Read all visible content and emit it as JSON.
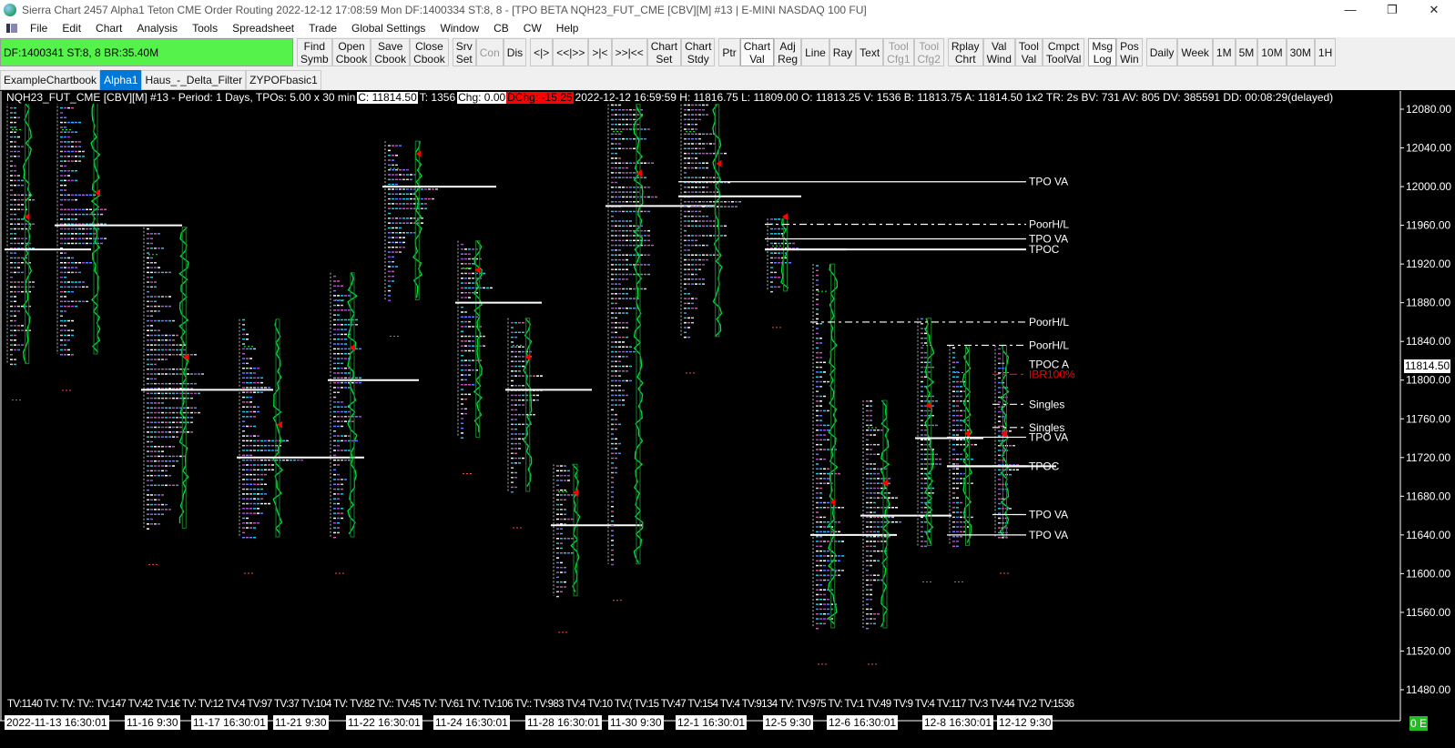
{
  "window": {
    "title": "Sierra Chart 2457 Alpha1  Teton CME Order Routing 2022-12-12  17:08:59 Mon  DF:1400334  ST:8, 8 - [TPO BETA NQH23_FUT_CME [CBV][M]  #13 | E-MINI NASDAQ 100 FU]",
    "minimize": "—",
    "restore": "❐",
    "close": "✕"
  },
  "menu": [
    "File",
    "Edit",
    "Chart",
    "Analysis",
    "Tools",
    "Spreadsheet",
    "Trade",
    "Global Settings",
    "Window",
    "CB",
    "CW",
    "Help"
  ],
  "status": "DF:1400341  ST:8, 8  BR:35.40M",
  "toolbar": [
    [
      {
        "l1": "Find",
        "l2": "Symb"
      },
      {
        "l1": "Open",
        "l2": "Cbook"
      },
      {
        "l1": "Save",
        "l2": "Cbook"
      },
      {
        "l1": "Close",
        "l2": "Cbook"
      }
    ],
    [
      {
        "l1": "Srv",
        "l2": "Set"
      },
      {
        "l1": "Con",
        "l2": "",
        "dis": true
      },
      {
        "l1": "Dis",
        "l2": ""
      }
    ],
    [
      {
        "l1": "<|>",
        "l2": ""
      },
      {
        "l1": "<<|>>",
        "l2": ""
      },
      {
        "l1": ">|<",
        "l2": ""
      },
      {
        "l1": ">>|<<",
        "l2": ""
      },
      {
        "l1": "Chart",
        "l2": "Set"
      },
      {
        "l1": "Chart",
        "l2": "Stdy"
      }
    ],
    [
      {
        "l1": "Ptr",
        "l2": ""
      },
      {
        "l1": "Chart",
        "l2": "Val",
        "act": true
      },
      {
        "l1": "Adj",
        "l2": "Reg"
      },
      {
        "l1": "Line",
        "l2": ""
      },
      {
        "l1": "Ray",
        "l2": ""
      },
      {
        "l1": "Text",
        "l2": ""
      },
      {
        "l1": "Tool",
        "l2": "Cfg1",
        "dis": true
      },
      {
        "l1": "Tool",
        "l2": "Cfg2",
        "dis": true
      }
    ],
    [
      {
        "l1": "Rplay",
        "l2": "Chrt"
      },
      {
        "l1": "Val",
        "l2": "Wind"
      },
      {
        "l1": "Tool",
        "l2": "Val"
      },
      {
        "l1": "Cmpct",
        "l2": "ToolVal"
      }
    ],
    [
      {
        "l1": "Msg",
        "l2": "Log",
        "act": true
      },
      {
        "l1": "Pos",
        "l2": "Win"
      }
    ],
    [
      {
        "l1": "Daily",
        "l2": ""
      },
      {
        "l1": "Week",
        "l2": ""
      },
      {
        "l1": "1M",
        "l2": ""
      },
      {
        "l1": "5M",
        "l2": ""
      },
      {
        "l1": "10M",
        "l2": ""
      },
      {
        "l1": "30M",
        "l2": ""
      },
      {
        "l1": "1H",
        "l2": ""
      }
    ]
  ],
  "tabs": [
    "ExampleChartbook",
    "Alpha1",
    "Haus_-_Delta_Filter",
    "ZYPOFbasic1"
  ],
  "header": {
    "symbol": "NQH23_FUT_CME [CBV][M]  #13 - Period: 1 Days, TPOs: 5.00 x 30 min ",
    "close": "C: 11814.50",
    "trades": "T: 1356",
    "chg": "Chg: 0.00",
    "dchg": "DChg: -15.25",
    "rest": "2022-12-12 16:59:59 H: 11816.75 L: 11809.00 O: 11813.25 V: 1536 B: 11813.75 A: 11814.50 1x2 TR: 2s BV: 731 AV: 805 DV: 385591 DD: 00:08:29(delayed)"
  },
  "last_price": "11814.50",
  "tv_row": "TV:1140 TV: TV: TV:: TV:147 TV:42 TV:1€ TV: TV:12 TV:4 TV:97 TV:37 TV:104 TV: TV:82 TV:: TV:45 TV: TV:61 TV: TV:106 TV:: TV:983 TV:4 TV:10 TV:( TV:15 TV:47 TV:154 TV:4 TV:9134 TV: TV:975 TV: TV:1 TV:49 TV:9 TV:4 TV:117 TV:3 TV:44 TV:2 TV:1536",
  "dates": [
    "2022-11-13  16:30:01",
    "11-16  9:30",
    "11-17  16:30:01",
    "11-21  9:30",
    "11-22  16:30:01",
    "11-24  16:30:01",
    "11-28  16:30:01",
    "11-30  9:30",
    "12-1  16:30:01",
    "12-5  9:30",
    "12-6  16:30:01",
    "12-8  16:30:01",
    "12-12  9:30"
  ],
  "oe_badge": "0 E",
  "colors": {
    "status_green": "#55f24b",
    "tab_selected": "#0078d7",
    "dchg_red": "#ff0000",
    "price_line": "#00e040",
    "tpo_cyan": "#29c6e0",
    "tpo_purple": "#a050c0"
  },
  "chart_data": {
    "type": "tpo-profile",
    "ylim": [
      11460,
      12095
    ],
    "y_ticks": [
      12080,
      12040,
      12000,
      11960,
      11920,
      11880,
      11840,
      11800,
      11760,
      11720,
      11680,
      11640,
      11600,
      11560,
      11520,
      11480
    ],
    "sessions": [
      {
        "high": 12087,
        "low": 11817,
        "poc": 11935
      },
      {
        "high": 12087,
        "low": 11827,
        "poc": 11960
      },
      {
        "high": 11958,
        "low": 11647,
        "poc": 11790
      },
      {
        "high": 11863,
        "low": 11638,
        "poc": 11720
      },
      {
        "high": 11911,
        "low": 11638,
        "poc": 11800
      },
      {
        "high": 12047,
        "low": 11883,
        "poc": 12000
      },
      {
        "high": 11944,
        "low": 11741,
        "poc": 11880
      },
      {
        "high": 11864,
        "low": 11685,
        "poc": 11790
      },
      {
        "high": 11713,
        "low": 11577,
        "poc": 11650
      },
      {
        "high": 12085,
        "low": 11610,
        "poc": 11980
      },
      {
        "high": 12085,
        "low": 11845,
        "poc": 11990
      },
      {
        "high": 11967,
        "low": 11892,
        "poc": 11935
      },
      {
        "high": 11920,
        "low": 11544,
        "poc": 11640
      },
      {
        "high": 11779,
        "low": 11544,
        "poc": 11660
      },
      {
        "high": 11864,
        "low": 11629,
        "poc": 11740
      },
      {
        "high": 11836,
        "low": 11629,
        "poc": 11711
      },
      {
        "high": 11836,
        "low": 11638,
        "poc": 11711
      }
    ],
    "levels": [
      {
        "price": 12005,
        "label": "TPO VA",
        "from": 10,
        "style": "solid"
      },
      {
        "price": 11961,
        "label": "PoorH/L",
        "from": 11,
        "style": "dash"
      },
      {
        "price": 11946,
        "label": "TPO VA",
        "from": 11,
        "style": "solid"
      },
      {
        "price": 11935,
        "label": "TPOC",
        "from": 11,
        "style": "thick"
      },
      {
        "price": 11860,
        "label": "PoorH/L",
        "from": 12,
        "style": "dash"
      },
      {
        "price": 11836,
        "label": "PoorH/L",
        "from": 15,
        "style": "dash"
      },
      {
        "price": 11816,
        "label": "TPOC A",
        "from": 16,
        "style": "none"
      },
      {
        "price": 11806,
        "label": "IBR100%",
        "from": 16,
        "style": "red"
      },
      {
        "price": 11775,
        "label": "Singles",
        "from": 16,
        "style": "dash"
      },
      {
        "price": 11751,
        "label": "Singles",
        "from": 16,
        "style": "dash"
      },
      {
        "price": 11741,
        "label": "TPO VA",
        "from": 15,
        "style": "solid"
      },
      {
        "price": 11711,
        "label": "TPOC",
        "from": 15,
        "style": "thick"
      },
      {
        "price": 11661,
        "label": "TPO VA",
        "from": 16,
        "style": "solid"
      },
      {
        "price": 11640,
        "label": "TPO VA",
        "from": 15,
        "style": "solid"
      }
    ]
  }
}
